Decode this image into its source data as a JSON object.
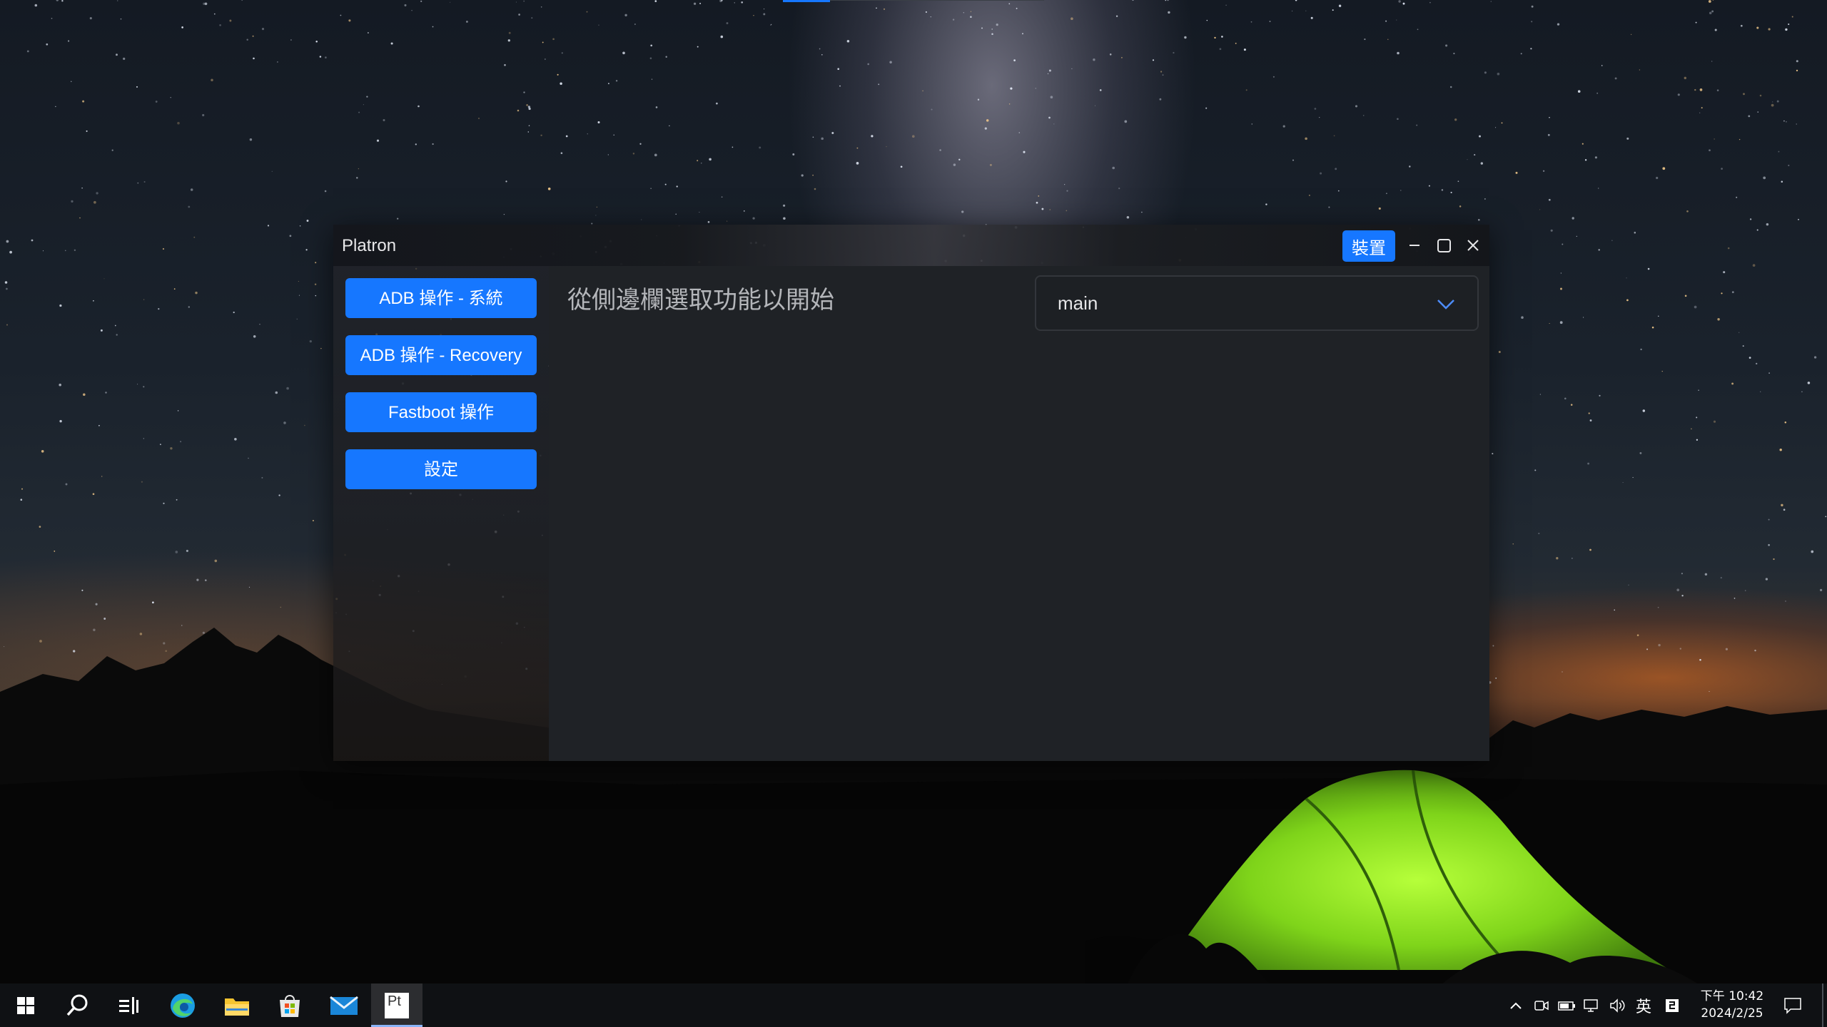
{
  "window": {
    "title": "Platron",
    "device_button": "裝置",
    "controls": {
      "minimize": "minimize-icon",
      "maximize": "maximize-icon",
      "close": "close-icon"
    }
  },
  "sidebar": {
    "items": [
      {
        "label": "ADB 操作 - 系統"
      },
      {
        "label": "ADB 操作 - Recovery"
      },
      {
        "label": "Fastboot 操作"
      },
      {
        "label": "設定"
      }
    ]
  },
  "main": {
    "hint": "從側邊欄選取功能以開始",
    "branch_select": {
      "value": "main",
      "icon": "chevron-down-icon"
    }
  },
  "taskbar": {
    "apps": [
      "windows-start-icon",
      "search-icon",
      "task-view-icon",
      "edge-icon",
      "file-explorer-icon",
      "store-icon",
      "mail-icon",
      "platron-icon"
    ],
    "platron_icon_text": "Pt",
    "tray": {
      "ime": "英",
      "time": "下午 10:42",
      "date": "2024/2/25"
    }
  },
  "colors": {
    "accent": "#1677ff",
    "main_bg": "#1f2226",
    "hint_text": "#b4b6ba"
  }
}
